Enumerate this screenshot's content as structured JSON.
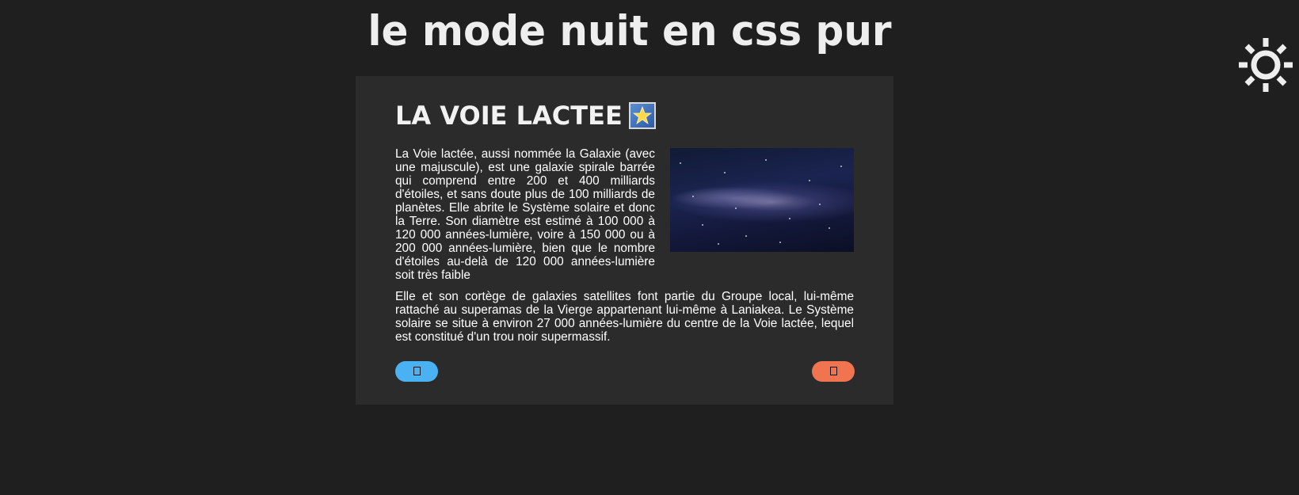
{
  "header": {
    "title": "Le mode nuit en CSS pur"
  },
  "theme_toggle": {
    "icon": "sun-icon",
    "color": "#eeeeee"
  },
  "article": {
    "title": "La Voie Lactee",
    "title_icon": "star-icon",
    "paragraph_1": "La Voie lactée, aussi nommée la Galaxie (avec une majuscule), est une galaxie spirale barrée qui comprend entre 200 et 400 milliards d'étoiles, et sans doute plus de 100 milliards de planètes. Elle abrite le Système solaire et donc la Terre. Son diamètre est estimé à 100 000 à 120 000 années-lumière, voire à 150 000 ou à 200 000 années-lumière, bien que le nombre d'étoiles au-delà de 120 000 années-lumière soit très faible",
    "paragraph_2": "Elle et son cortège de galaxies satellites font partie du Groupe local, lui-même rattaché au superamas de la Vierge appartenant lui-même à Laniakea. Le Système solaire se situe à environ 27 000 années-lumière du centre de la Voie lactée, lequel est constitué d'un trou noir supermassif.",
    "image_icon": "milky-way-image"
  },
  "actions": {
    "left_button_color": "#4ab2f2",
    "right_button_color": "#f07450",
    "left_button_icon": "missing-glyph-icon",
    "right_button_icon": "missing-glyph-icon"
  },
  "colors": {
    "page_background": "#1f1f1f",
    "card_background": "#2b2b2b",
    "text": "#ffffff"
  }
}
